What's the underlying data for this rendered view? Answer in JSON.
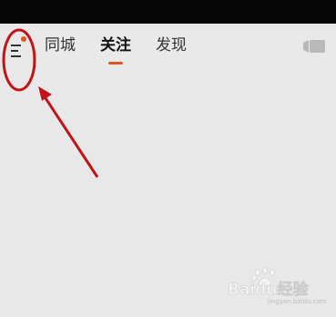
{
  "nav": {
    "tabs": [
      {
        "label": "同城",
        "active": false
      },
      {
        "label": "关注",
        "active": true
      },
      {
        "label": "发现",
        "active": false
      }
    ]
  },
  "icons": {
    "menu": "menu-icon",
    "notification_dot": "notification-dot-icon",
    "camera": "video-camera-icon"
  },
  "colors": {
    "accent": "#e0541e",
    "annotation": "#c0141a",
    "background": "#e8e8e8",
    "status_bar": "#050505"
  },
  "watermark": {
    "brand": "Baidu经验",
    "url": "jingyan.baidu.com"
  }
}
